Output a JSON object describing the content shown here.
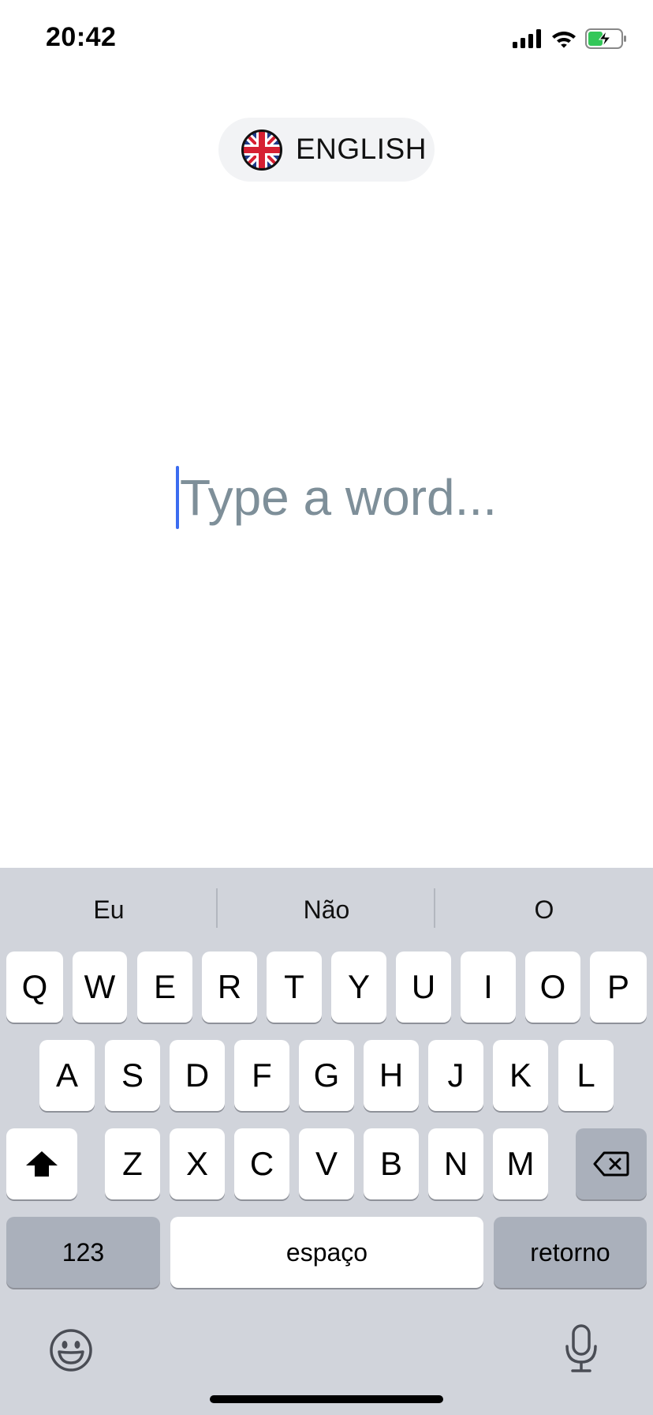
{
  "status_bar": {
    "time": "20:42",
    "icons": [
      "cellular-signal-icon",
      "wifi-icon",
      "battery-charging-icon"
    ]
  },
  "language": {
    "label": "ENGLISH",
    "flag_icon": "uk-flag-icon"
  },
  "word_input": {
    "placeholder": "Type a word...",
    "value": ""
  },
  "keyboard": {
    "suggestions": [
      "Eu",
      "Não",
      "O"
    ],
    "row1": [
      "Q",
      "W",
      "E",
      "R",
      "T",
      "Y",
      "U",
      "I",
      "O",
      "P"
    ],
    "row2": [
      "A",
      "S",
      "D",
      "F",
      "G",
      "H",
      "J",
      "K",
      "L"
    ],
    "row3": [
      "Z",
      "X",
      "C",
      "V",
      "B",
      "N",
      "M"
    ],
    "numbers_label": "123",
    "space_label": "espaço",
    "return_label": "retorno",
    "shift_icon": "shift-icon",
    "delete_icon": "backspace-icon",
    "emoji_icon": "emoji-icon",
    "mic_icon": "microphone-icon"
  },
  "colors": {
    "accent": "#3b6cf0",
    "placeholder": "#7e8f99",
    "keyboard_bg": "#d1d4db",
    "pill_bg": "#f2f3f5",
    "battery_green": "#34c759"
  }
}
